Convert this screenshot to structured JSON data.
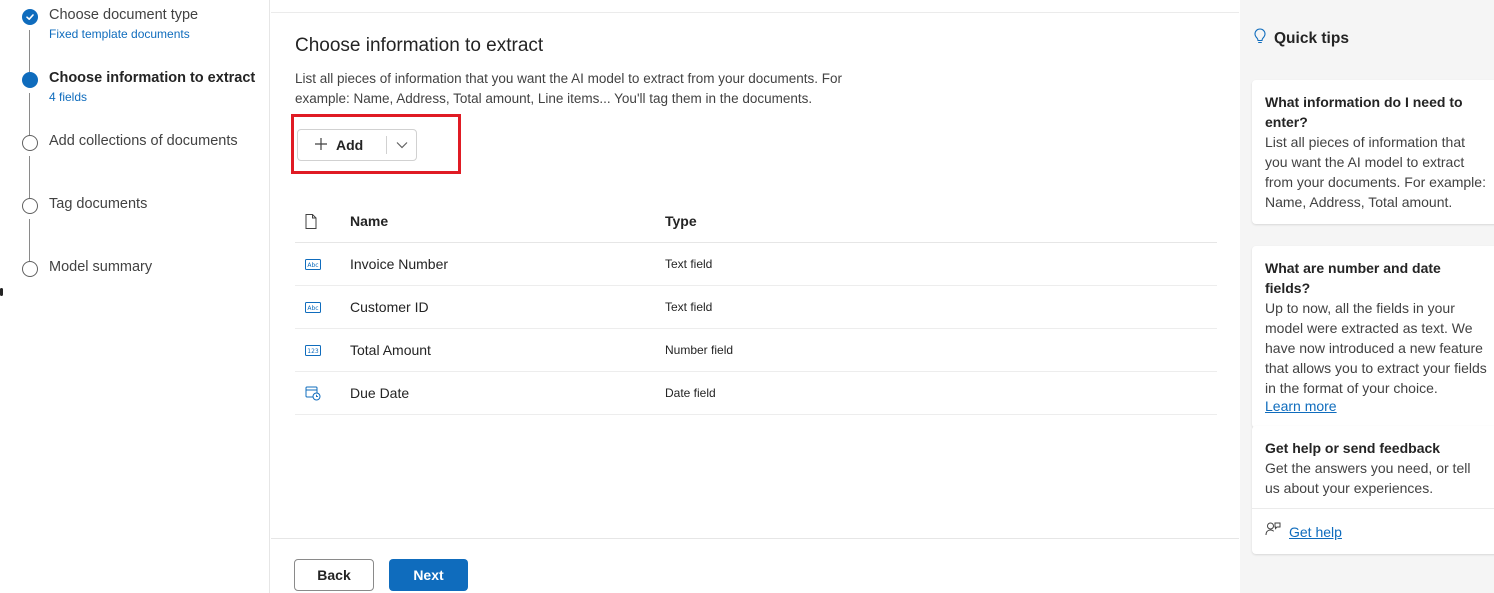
{
  "stepper": {
    "steps": [
      {
        "label": "Choose document type",
        "sub": "Fixed template documents",
        "status": "done"
      },
      {
        "label": "Choose information to extract",
        "sub": "4 fields",
        "status": "current"
      },
      {
        "label": "Add collections of documents",
        "status": "todo"
      },
      {
        "label": "Tag documents",
        "status": "todo"
      },
      {
        "label": "Model summary",
        "status": "todo"
      }
    ]
  },
  "main": {
    "title": "Choose information to extract",
    "description": "List all pieces of information that you want the AI model to extract from your documents. For example: Name, Address, Total amount, Line items... You'll tag them in the documents.",
    "add_label": "Add",
    "table": {
      "header_icon": "document-icon",
      "columns": [
        "Name",
        "Type"
      ],
      "rows": [
        {
          "icon": "text-field-icon",
          "name": "Invoice Number",
          "type": "Text field"
        },
        {
          "icon": "text-field-icon",
          "name": "Customer ID",
          "type": "Text field"
        },
        {
          "icon": "number-field-icon",
          "name": "Total Amount",
          "type": "Number field"
        },
        {
          "icon": "date-field-icon",
          "name": "Due Date",
          "type": "Date field"
        }
      ]
    },
    "back_label": "Back",
    "next_label": "Next"
  },
  "tips": {
    "title": "Quick tips",
    "cards": [
      {
        "title": "What information do I need to enter?",
        "body": "List all pieces of information that you want the AI model to extract from your documents. For example: Name, Address, Total amount."
      },
      {
        "title": "What are number and date fields?",
        "body": "Up to now, all the fields in your model were extracted as text. We have now introduced a new feature that allows you to extract your fields in the format of your choice.",
        "link": "Learn more"
      },
      {
        "title": "Get help or send feedback",
        "body": "Get the answers you need, or tell us about your experiences.",
        "link": "Get help"
      }
    ]
  },
  "colors": {
    "accent": "#0f6cbd",
    "highlight": "#e01b24"
  }
}
